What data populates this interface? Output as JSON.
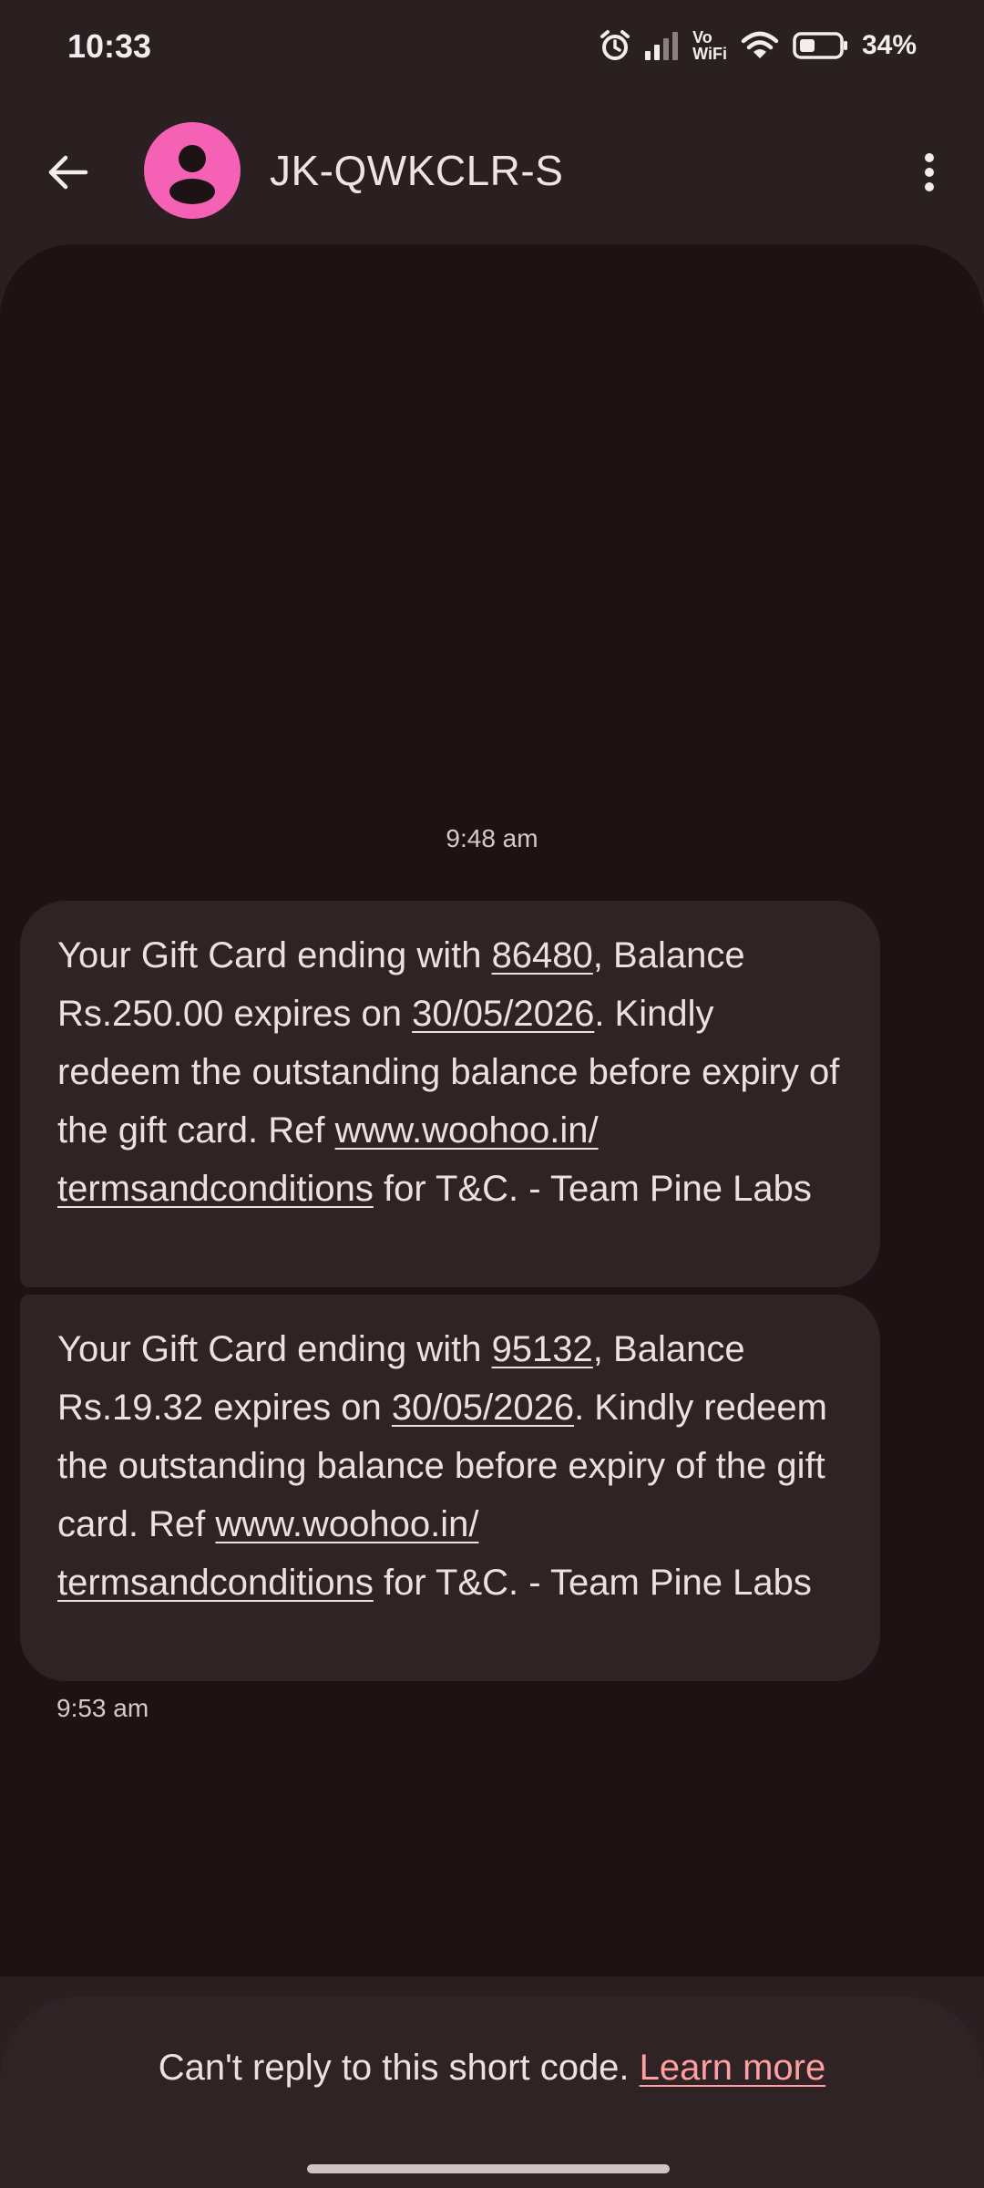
{
  "status_bar": {
    "time": "10:33",
    "vowifi_line1": "Vo",
    "vowifi_line2": "WiFi",
    "battery_percent": "34%",
    "icons": [
      "alarm-icon",
      "signal-icon",
      "wifi-icon",
      "battery-icon"
    ]
  },
  "header": {
    "contact_name": "JK-QWKCLR-S",
    "avatar_color": "#f562b5",
    "icons": [
      "back-arrow-icon",
      "person-icon",
      "more-vert-icon"
    ]
  },
  "conversation": {
    "first_timestamp": "9:48 am",
    "messages": [
      {
        "pre": "Your Gift Card ending with ",
        "card": "86480",
        "mid1": ", Balance Rs.250.00 expires on ",
        "date": "30/05/2026",
        "mid2": ". Kindly redeem the outstanding balance before expiry of the gift card. Ref ",
        "link": "www.woohoo.in/termsandconditions",
        "post": " for T&C. - Team Pine Labs"
      },
      {
        "pre": "Your Gift Card ending with ",
        "card": "95132",
        "mid1": ", Balance Rs.19.32 expires on ",
        "date": "30/05/2026",
        "mid2": ". Kindly redeem the outstanding balance before expiry of the gift card. Ref ",
        "link": "www.woohoo.in/termsandconditions",
        "post": " for T&C. - Team Pine Labs"
      }
    ],
    "last_timestamp": "9:53 am"
  },
  "footer": {
    "notice": "Can't reply to this short code. ",
    "learn_more": "Learn more",
    "link_color": "#ff9fa0"
  }
}
